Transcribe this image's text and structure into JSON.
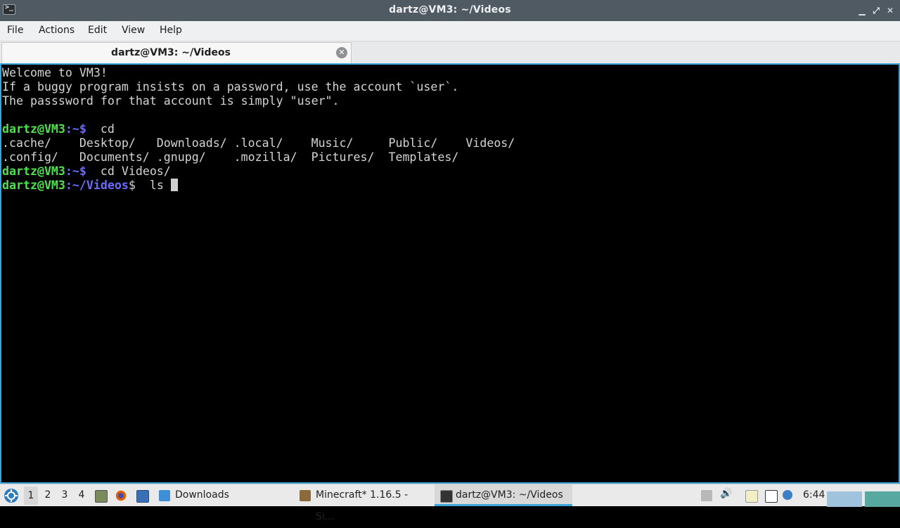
{
  "window": {
    "title": "dartz@VM3: ~/Videos",
    "icon": "terminal-icon",
    "controls": {
      "minimize": "▁",
      "maximize": "⤢",
      "close": "✕"
    }
  },
  "menu": {
    "file": "File",
    "actions": "Actions",
    "edit": "Edit",
    "view": "View",
    "help": "Help"
  },
  "tab": {
    "label": "dartz@VM3: ~/Videos",
    "close": "✕"
  },
  "terminal": {
    "welcome": "Welcome to VM3!",
    "note1": "If a buggy program insists on a password, use the account `user`.",
    "note2": "The passsword for that account is simply \"user\".",
    "prompt_user": "dartz@VM3",
    "prompt_home": ":~$",
    "prompt_videos_path": ":~/Videos",
    "prompt_dollar": "$",
    "cmd1": "  cd",
    "ls_row1": ".cache/    Desktop/   Downloads/ .local/    Music/     Public/    Videos/",
    "ls_row2": ".config/   Documents/ .gnupg/    .mozilla/  Pictures/  Templates/",
    "cmd2": "  cd Videos/",
    "cmd3": "  ls "
  },
  "taskbar": {
    "workspaces": [
      "1",
      "2",
      "3",
      "4"
    ],
    "tasks": {
      "downloads": "Downloads",
      "minecraft": "Minecraft* 1.16.5 - Si...",
      "terminal": "dartz@VM3: ~/Videos"
    },
    "clock": "6:44"
  },
  "colors": {
    "titlebar": "#4f5a62",
    "accent": "#3da3d8",
    "prompt_user": "#4ee34e",
    "prompt_path": "#6b6bff"
  }
}
